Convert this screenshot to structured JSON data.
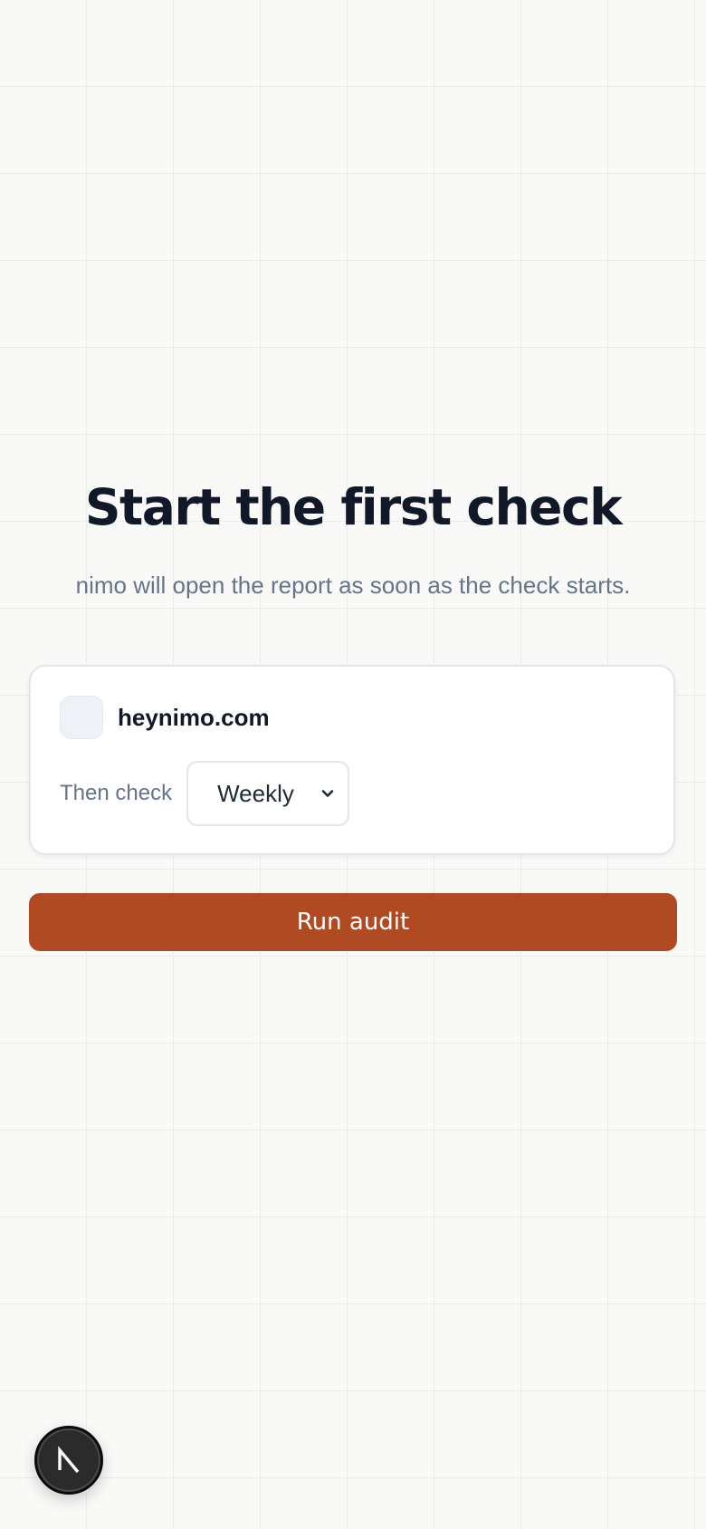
{
  "header": {
    "title": "Start the first check",
    "subtitle": "nimo will open the report as soon as the check starts."
  },
  "card": {
    "site": {
      "domain": "heynimo.com",
      "favicon_icon": "favicon-placeholder-icon"
    },
    "schedule": {
      "label": "Then check",
      "selected": "Weekly",
      "icon": "chevron-down-icon"
    }
  },
  "actions": {
    "run_label": "Run audit"
  },
  "dev_badge": {
    "letter": "N",
    "icon": "nextjs-logo-icon"
  },
  "colors": {
    "background": "#f9f9f8",
    "title": "#111827",
    "muted": "#64748b",
    "accent": "#b04a22",
    "card_border": "#e2e5ec"
  }
}
